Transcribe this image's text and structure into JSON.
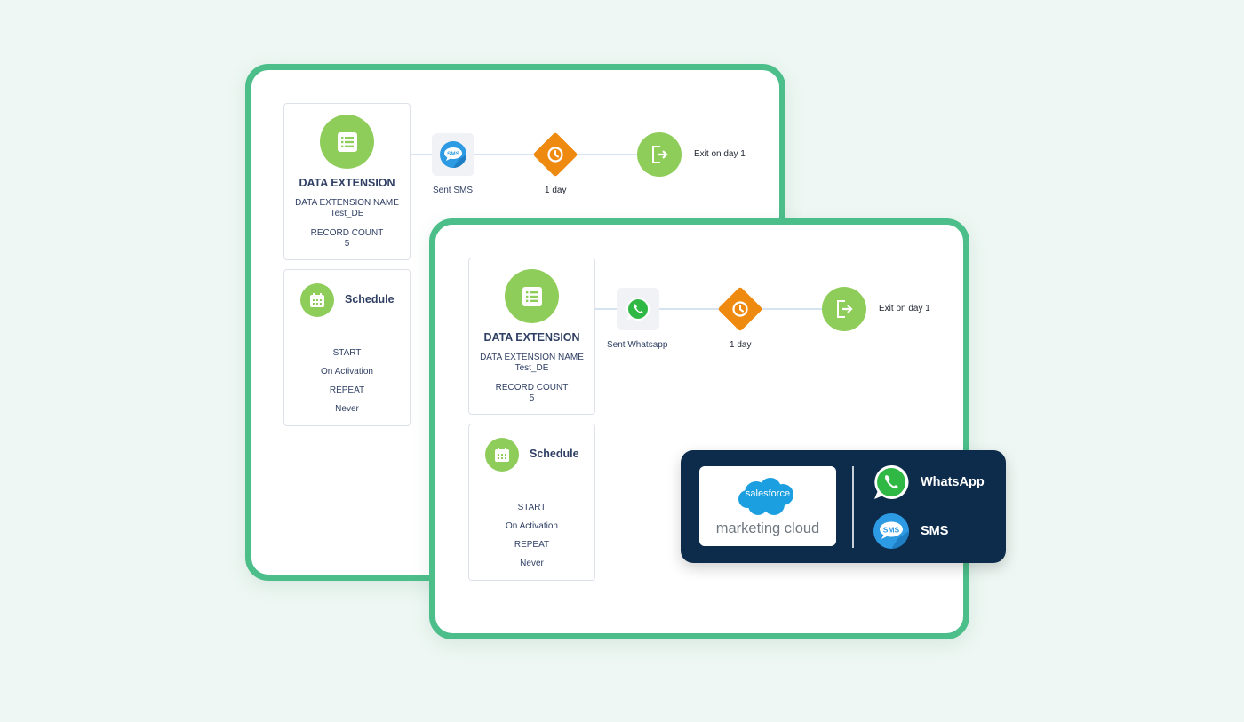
{
  "journeys": [
    {
      "entry": {
        "title": "DATA EXTENSION",
        "name_label": "DATA EXTENSION NAME",
        "name_value": "Test_DE",
        "count_label": "RECORD COUNT",
        "count_value": "5",
        "icon": "list-icon"
      },
      "schedule": {
        "title": "Schedule",
        "start_label": "START",
        "start_value": "On Activation",
        "repeat_label": "REPEAT",
        "repeat_value": "Never",
        "icon": "calendar-icon"
      },
      "activity": {
        "label": "Sent SMS",
        "icon": "sms-icon"
      },
      "wait": {
        "label": "1 day",
        "icon": "clock-icon"
      },
      "exit": {
        "label": "Exit on day 1",
        "icon": "exit-icon"
      }
    },
    {
      "entry": {
        "title": "DATA EXTENSION",
        "name_label": "DATA EXTENSION NAME",
        "name_value": "Test_DE",
        "count_label": "RECORD COUNT",
        "count_value": "5",
        "icon": "list-icon"
      },
      "schedule": {
        "title": "Schedule",
        "start_label": "START",
        "start_value": "On Activation",
        "repeat_label": "REPEAT",
        "repeat_value": "Never",
        "icon": "calendar-icon"
      },
      "activity": {
        "label": "Sent Whatsapp",
        "icon": "whatsapp-icon"
      },
      "wait": {
        "label": "1 day",
        "icon": "clock-icon"
      },
      "exit": {
        "label": "Exit on day 1",
        "icon": "exit-icon"
      }
    }
  ],
  "badge": {
    "brand_word": "salesforce",
    "product_word": "marketing cloud",
    "channels": [
      {
        "label": "WhatsApp",
        "icon": "whatsapp-icon"
      },
      {
        "label": "SMS",
        "icon": "sms-icon"
      }
    ]
  },
  "colors": {
    "frame_border": "#4cbe8a",
    "node_green": "#8fcd5b",
    "wait_orange": "#ef8a10",
    "badge_bg": "#0d2c4b",
    "text_navy": "#2f3f64",
    "background": "#eef7f3"
  }
}
